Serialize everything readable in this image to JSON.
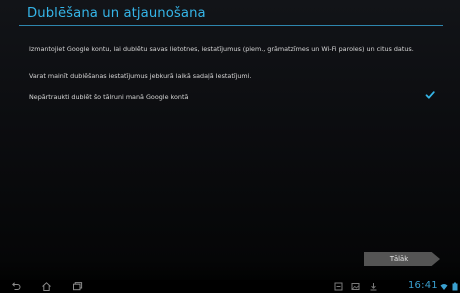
{
  "setup": {
    "title": "Dublēšana un atjaunošana",
    "description": "Izmantojiet Google kontu, lai dublētu savas lietotnes, iestatījumus (piem., grāmatzīmes un Wi-Fi paroles) un citus datus.",
    "change_info": "Varat mainīt dublēšanas iestatījumus jebkurā laikā sadaļā Iestatījumi.",
    "backup_option_label": "Nepārtraukti dublēt šo tālruni manā Google kontā",
    "backup_option_checked": true,
    "next_label": "Tālāk"
  },
  "navbar": {
    "buttons": [
      "back-icon",
      "home-icon",
      "recent-apps-icon"
    ],
    "tray_icons": [
      "screenshot-icon",
      "gallery-icon",
      "download-icon"
    ],
    "clock": "16:41",
    "status_icons": [
      "wifi-icon",
      "battery-icon"
    ]
  },
  "colors": {
    "accent": "#35b5e8",
    "button": "#545454",
    "clock": "#3aa0cf"
  }
}
